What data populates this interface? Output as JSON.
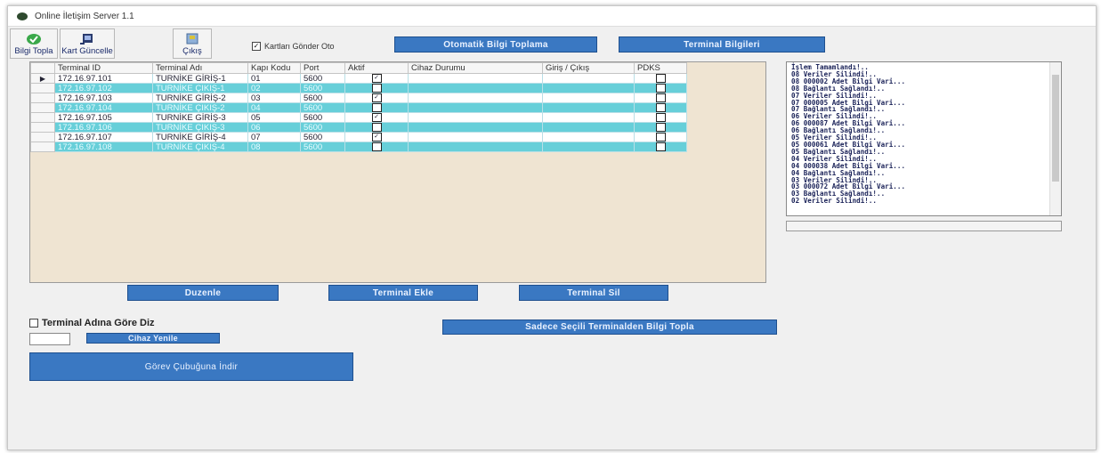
{
  "window": {
    "title": "Online İletişim Server 1.1"
  },
  "toolbar": {
    "collect_label": "Bilgi Topla",
    "card_update_label": "Kart Güncelle",
    "exit_label": "Çıkış",
    "send_cards_label": "Kartları Gönder Oto",
    "send_cards_checked": true,
    "auto_collect_label": "Otomatik Bilgi Toplama",
    "terminal_info_label": "Terminal Bilgileri"
  },
  "grid": {
    "columns": [
      "Terminal ID",
      "Terminal Adı",
      "Kapı Kodu",
      "Port",
      "Aktif",
      "Cihaz Durumu",
      "Giriş / Çıkış",
      "PDKS"
    ],
    "rows": [
      {
        "id": "172.16.97.101",
        "name": "TURNİKE GİRİŞ-1",
        "door": "01",
        "port": "5600",
        "aktif": true,
        "status": "",
        "io": "",
        "pdks": false
      },
      {
        "id": "172.16.97.102",
        "name": "TURNİKE ÇIKIŞ-1",
        "door": "02",
        "port": "5600",
        "aktif": true,
        "status": "",
        "io": "",
        "pdks": false
      },
      {
        "id": "172.16.97.103",
        "name": "TURNİKE GİRİŞ-2",
        "door": "03",
        "port": "5600",
        "aktif": true,
        "status": "",
        "io": "",
        "pdks": false
      },
      {
        "id": "172.16.97.104",
        "name": "TURNİKE ÇIKIŞ-2",
        "door": "04",
        "port": "5600",
        "aktif": true,
        "status": "",
        "io": "",
        "pdks": false
      },
      {
        "id": "172.16.97.105",
        "name": "TURNİKE GİRİŞ-3",
        "door": "05",
        "port": "5600",
        "aktif": true,
        "status": "",
        "io": "",
        "pdks": false
      },
      {
        "id": "172.16.97.106",
        "name": "TURNİKE ÇIKIŞ-3",
        "door": "06",
        "port": "5600",
        "aktif": true,
        "status": "",
        "io": "",
        "pdks": false
      },
      {
        "id": "172.16.97.107",
        "name": "TURNİKE GİRİŞ-4",
        "door": "07",
        "port": "5600",
        "aktif": true,
        "status": "",
        "io": "",
        "pdks": false
      },
      {
        "id": "172.16.97.108",
        "name": "TURNİKE ÇIKIŞ-4",
        "door": "08",
        "port": "5600",
        "aktif": true,
        "status": "",
        "io": "",
        "pdks": false
      }
    ],
    "row_indicator": "▶"
  },
  "log": {
    "lines": [
      "İşlem Tamamlandı!..",
      "08 Veriler Silindi!..",
      "08 000002 Adet Bilgi Vari...",
      "08 Bağlantı Sağlandı!..",
      "07 Veriler Silindi!..",
      "07 000005 Adet Bilgi Vari...",
      "07 Bağlantı Sağlandı!..",
      "06 Veriler Silindi!..",
      "06 000087 Adet Bilgi Vari...",
      "06 Bağlantı Sağlandı!..",
      "05 Veriler Silindi!..",
      "05 000061 Adet Bilgi Vari...",
      "05 Bağlantı Sağlandı!..",
      "04 Veriler Silindi!..",
      "04 000038 Adet Bilgi Vari...",
      "04 Bağlantı Sağlandı!..",
      "03 Veriler Silindi!..",
      "03 000072 Adet Bilgi Vari...",
      "03 Bağlantı Sağlandı!..",
      "02 Veriler Silindi!.."
    ]
  },
  "actions": {
    "edit_label": "Duzenle",
    "add_terminal_label": "Terminal Ekle",
    "delete_terminal_label": "Terminal Sil",
    "sort_by_name_label": "Terminal Adına Göre Diz",
    "sort_by_name_checked": false,
    "refresh_device_label": "Cihaz Yenile",
    "collect_selected_label": "Sadece Seçili Terminalden Bilgi Topla",
    "minimize_taskbar_label": "Görev Çubuğuna İndir"
  },
  "colors": {
    "accent_button": "#3a78c2",
    "row_alt": "#67cfd9",
    "grid_bg": "#efe4d2"
  }
}
